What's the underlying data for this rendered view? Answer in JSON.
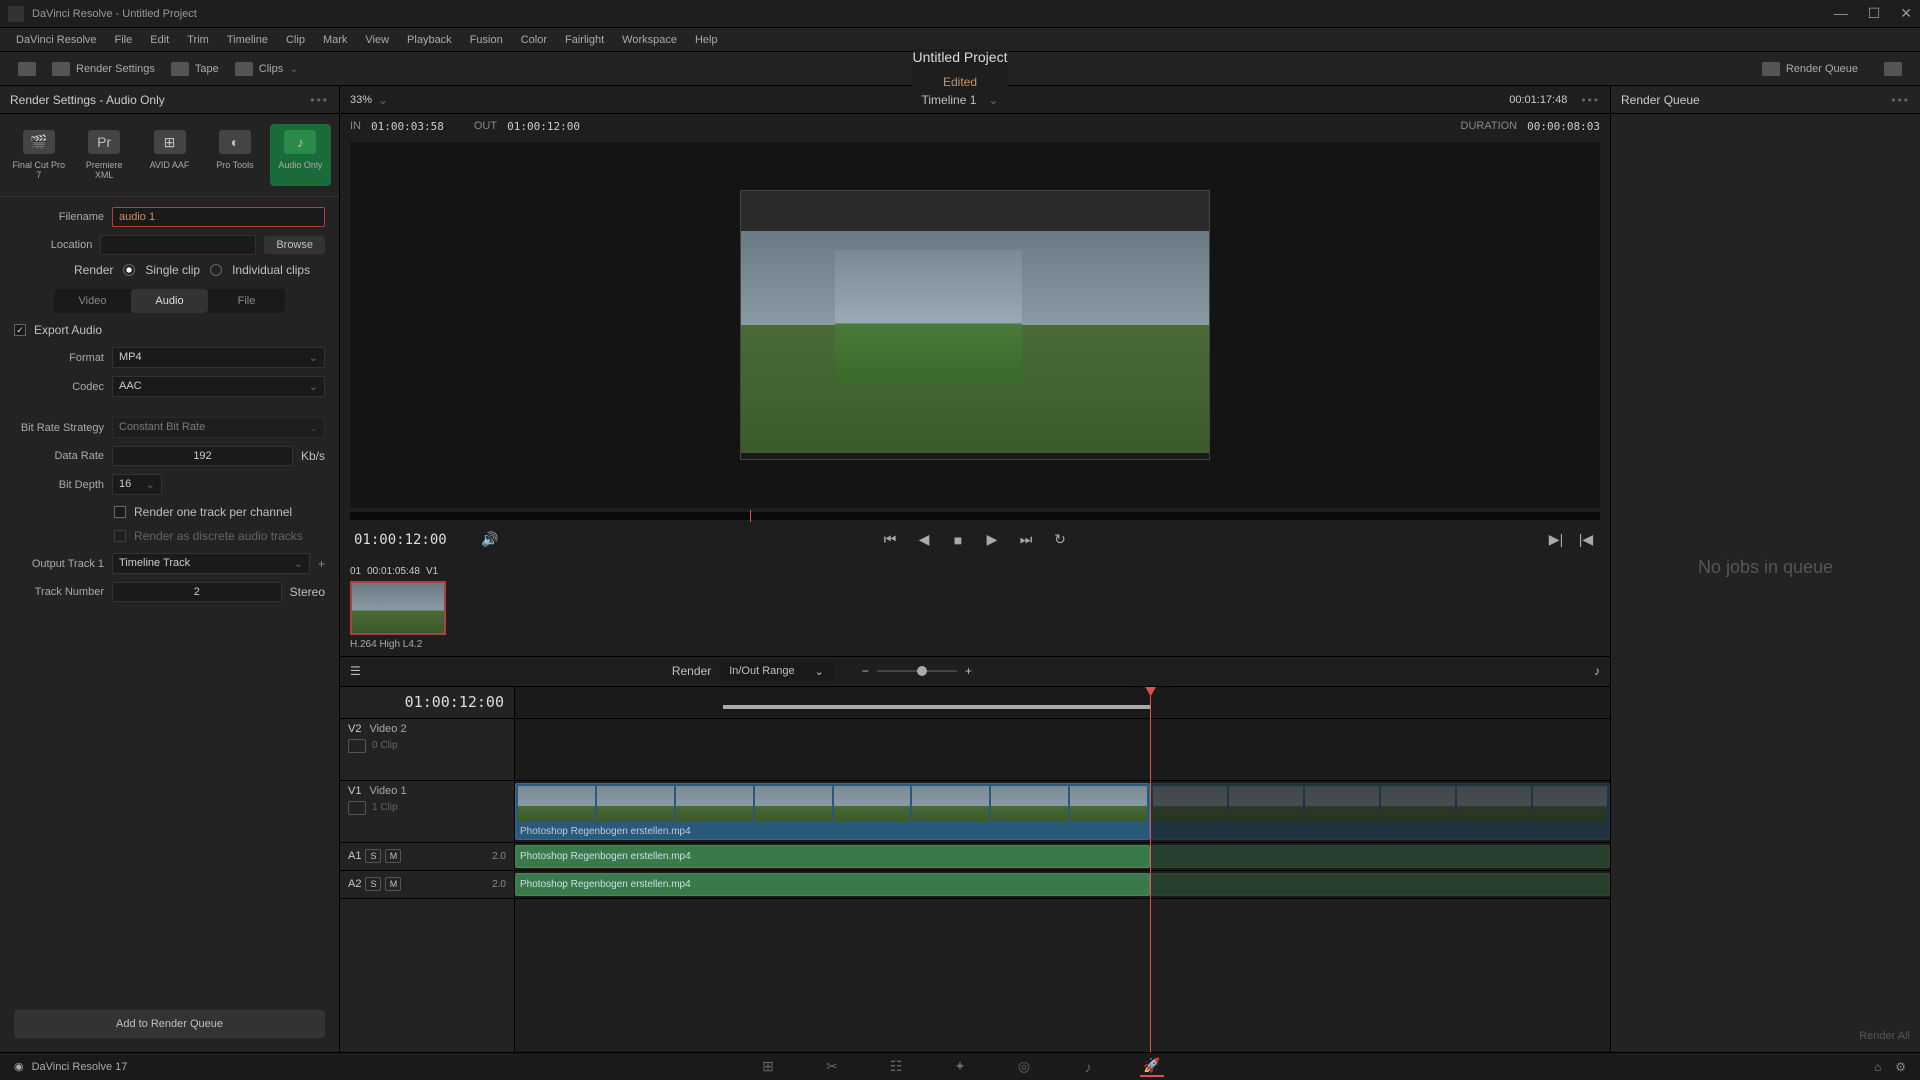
{
  "window": {
    "title": "DaVinci Resolve - Untitled Project"
  },
  "menu": {
    "items": [
      "DaVinci Resolve",
      "File",
      "Edit",
      "Trim",
      "Timeline",
      "Clip",
      "Mark",
      "View",
      "Playback",
      "Fusion",
      "Color",
      "Fairlight",
      "Workspace",
      "Help"
    ]
  },
  "toolbar": {
    "render_settings": "Render Settings",
    "tape": "Tape",
    "clips": "Clips",
    "project": "Untitled Project",
    "edited": "Edited",
    "render_queue": "Render Queue"
  },
  "render": {
    "panel_title": "Render Settings - Audio Only",
    "presets": [
      {
        "label": "Final Cut Pro 7",
        "icon": "🎬"
      },
      {
        "label": "Premiere XML",
        "icon": "Pr"
      },
      {
        "label": "AVID AAF",
        "icon": "⊞"
      },
      {
        "label": "Pro Tools",
        "icon": "◐"
      },
      {
        "label": "Audio Only",
        "icon": "♪"
      }
    ],
    "filename_label": "Filename",
    "filename": "audio 1",
    "location_label": "Location",
    "location": "",
    "browse": "Browse",
    "render_label": "Render",
    "single_clip": "Single clip",
    "individual": "Individual clips",
    "tabs": {
      "video": "Video",
      "audio": "Audio",
      "file": "File"
    },
    "export_audio": "Export Audio",
    "format_label": "Format",
    "format": "MP4",
    "codec_label": "Codec",
    "codec": "AAC",
    "bitrate_strategy_label": "Bit Rate Strategy",
    "bitrate_strategy": "Constant Bit Rate",
    "data_rate_label": "Data Rate",
    "data_rate": "192",
    "data_rate_unit": "Kb/s",
    "bit_depth_label": "Bit Depth",
    "bit_depth": "16",
    "one_track": "Render one track per channel",
    "discrete": "Render as discrete audio tracks",
    "output_track_label": "Output Track 1",
    "output_track": "Timeline Track",
    "track_number_label": "Track Number",
    "track_number": "2",
    "stereo": "Stereo",
    "add_queue": "Add to Render Queue"
  },
  "viewer": {
    "zoom": "33%",
    "timeline_name": "Timeline 1",
    "source_tc": "00:01:17:48",
    "in_label": "IN",
    "in_tc": "01:00:03:58",
    "out_label": "OUT",
    "out_tc": "01:00:12:00",
    "duration_label": "DURATION",
    "duration": "00:00:08:03",
    "playhead_tc": "01:00:12:00"
  },
  "clip": {
    "index": "01",
    "tc": "00:01:05:48",
    "track": "V1",
    "name": "H.264 High L4.2"
  },
  "timeline_tools": {
    "render": "Render",
    "range": "In/Out Range"
  },
  "timeline": {
    "tc": "01:00:12:00",
    "tracks": {
      "v2": {
        "id": "V2",
        "name": "Video 2",
        "clips": "0 Clip"
      },
      "v1": {
        "id": "V1",
        "name": "Video 1",
        "clips": "1 Clip"
      },
      "a1": {
        "id": "A1",
        "ch": "2.0"
      },
      "a2": {
        "id": "A2",
        "ch": "2.0"
      }
    },
    "clip_name": "Photoshop Regenbogen erstellen.mp4"
  },
  "queue": {
    "title": "Render Queue",
    "empty": "No jobs in queue",
    "render_all": "Render All"
  },
  "bottom": {
    "version": "DaVinci Resolve 17"
  }
}
